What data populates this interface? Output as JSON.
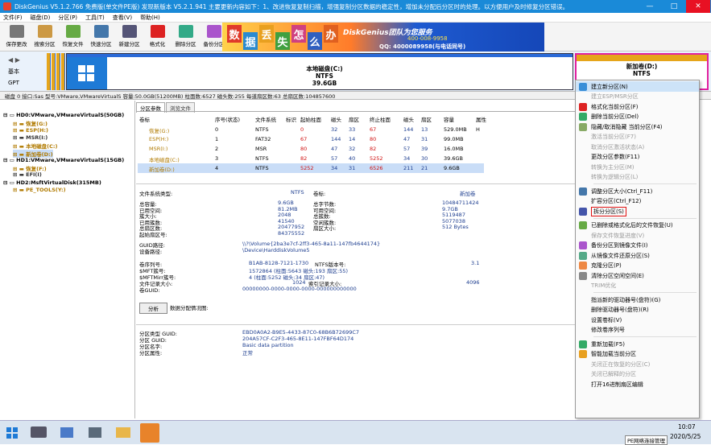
{
  "window": {
    "title": "DiskGenius V5.1.2.766 免费版(单文件PE版)   发现新版本 V5.2.1.941 主要更新内容如下：1、改进恢复复制扫描，增强复制分区数据的稳定性，增加未分配后分区时的处理。以方便用户及时修复分区错误。",
    "minimize": "—",
    "maximize": "□",
    "close": "✕"
  },
  "menu": [
    "文件(F)",
    "磁盘(D)",
    "分区(P)",
    "工具(T)",
    "查看(V)",
    "帮助(H)"
  ],
  "toolbar": [
    {
      "label": "保存更改",
      "icon": "save-icon",
      "color": "#777"
    },
    {
      "label": "搜索分区",
      "icon": "search-icon",
      "color": "#c94"
    },
    {
      "label": "恢复文件",
      "icon": "recover-icon",
      "color": "#6a4"
    },
    {
      "label": "快速分区",
      "icon": "quick-partition-icon",
      "color": "#47a"
    },
    {
      "label": "新建分区",
      "icon": "new-partition-icon",
      "color": "#557"
    },
    {
      "label": "格式化",
      "icon": "format-icon",
      "color": "#d22"
    },
    {
      "label": "删除分区",
      "icon": "delete-icon",
      "color": "#3a8"
    },
    {
      "label": "备份分区",
      "icon": "backup-icon",
      "color": "#a5c"
    }
  ],
  "banner": {
    "chars": [
      "数",
      "据",
      "丢",
      "失",
      "怎",
      "么",
      "办"
    ],
    "brand": "DiskGenius团队为您服务",
    "phone": "400-008-9958",
    "qq": "QQ: 4000089958(与电话同号)"
  },
  "diskmap": {
    "basic": "基本",
    "gpt": "GPT",
    "c": {
      "name": "本地磁盘(C:)",
      "fs": "NTFS",
      "size": "39.6GB"
    },
    "d": {
      "name": "新加卷(D:)",
      "fs": "NTFS",
      "size": "9.6GB"
    }
  },
  "diskinfo": "磁盘 0 接口:Sas  型号:VMware,VMwareVirtualS  容量:50.0GB(51200MB)  柱面数:6527  磁头数:255  每道扇区数:63  总扇区数:104857600",
  "tree": [
    {
      "text": "HD0:VMware,VMwareVirtualS(50GB)",
      "color": "#000"
    },
    {
      "text": "恢复(G:)",
      "color": "#b07a00"
    },
    {
      "text": "ESP(H:)",
      "color": "#b07a00"
    },
    {
      "text": "MSR(I:)",
      "color": "#333"
    },
    {
      "text": "本地磁盘(C:)",
      "color": "#b07a00"
    },
    {
      "text": "新加卷(D:)",
      "color": "#b07a00"
    },
    {
      "text": "HD1:VMware,VMwareVirtualS(15GB)",
      "color": "#000"
    },
    {
      "text": "恢复(F:)",
      "color": "#b07a00"
    },
    {
      "text": "EFI(I)",
      "color": "#333"
    },
    {
      "text": "HD2:MsftVirtualDisk(315MB)",
      "color": "#000"
    },
    {
      "text": "PE_TOOLS(Y:)",
      "color": "#b07a00"
    }
  ],
  "tabs": [
    "分区参数",
    "浏览文件"
  ],
  "table": {
    "headers": [
      "卷标",
      "序号(状态)",
      "文件系统",
      "标识",
      "起始柱面",
      "磁头",
      "扇区",
      "终止柱面",
      "磁头",
      "扇区",
      "容量",
      "属性"
    ],
    "rows": [
      [
        "恢复(G:)",
        "0",
        "NTFS",
        "",
        "0",
        "32",
        "33",
        "67",
        "144",
        "13",
        "529.0MB",
        "H"
      ],
      [
        "ESP(H:)",
        "1",
        "FAT32",
        "",
        "67",
        "144",
        "14",
        "80",
        "47",
        "31",
        "99.0MB",
        ""
      ],
      [
        "MSR(I:)",
        "2",
        "MSR",
        "",
        "80",
        "47",
        "32",
        "82",
        "57",
        "39",
        "16.0MB",
        ""
      ],
      [
        "本地磁盘(C:)",
        "3",
        "NTFS",
        "",
        "82",
        "57",
        "40",
        "5252",
        "34",
        "30",
        "39.6GB",
        ""
      ],
      [
        "新加卷(D:)",
        "4",
        "NTFS",
        "",
        "5252",
        "34",
        "31",
        "6526",
        "211",
        "21",
        "9.6GB",
        ""
      ]
    ]
  },
  "details": {
    "fs_label": "文件系统类型:",
    "fs": "NTFS",
    "vol_label": "卷标:",
    "vol": "新加卷",
    "rows": [
      [
        "总容量:",
        "9.6GB",
        "总字节数:",
        "10484711424"
      ],
      [
        "已用空间:",
        "81.2MB",
        "可用空间:",
        "9.7GB"
      ],
      [
        "簇大小:",
        "2048",
        "总簇数:",
        "5119487"
      ],
      [
        "已用簇数:",
        "41540",
        "空闲簇数:",
        "5077038"
      ],
      [
        "总扇区数:",
        "20477952",
        "扇区大小:",
        "512 Bytes"
      ],
      [
        "起始扇区号:",
        "84375552",
        "",
        ""
      ]
    ],
    "guid_path_label": "GUID路径:",
    "guid_path": "\\\\?\\Volume{2ba3e7cf-2ff3-465-8a11-147fb4644174}",
    "dev_label": "设备路径:",
    "dev": "\\Device\\HarddiskVolume5",
    "serial_label": "卷序列号:",
    "serial": "B1AB-8128-7121-1730",
    "ntfs_ver_label": "NTFS版本号:",
    "ntfs_ver": "3.1",
    "mft_label": "$MFT簇号:",
    "mft": "1572864 (柱面:5643 磁头:193 扇区:55)",
    "mftmirr_label": "$MFTMirr簇号:",
    "mftmirr": "4 (柱面:5252 磁头:34 扇区:47)",
    "rec_label": "文件记录大小:",
    "rec": "1024",
    "idx_label": "索引记录大小:",
    "idx": "4096",
    "guid_label": "卷GUID:",
    "guid": "00000000-0000-0000-0000-000000000000",
    "analyze_btn": "分析",
    "chart_label": "数据分配情况图:",
    "ptype_label": "分区类型 GUID:",
    "ptype": "EBD0A0A2-B9E5-4433-87C0-68B6B72699C7",
    "pguid_label": "分区 GUID:",
    "pguid": "204A57CF-C2F3-465-8E11-147FBF64D174",
    "pname_label": "分区名字:",
    "pname": "Basic data partition",
    "pattr_label": "分区属性:",
    "pattr": "正常"
  },
  "context_menu": [
    {
      "label": "建立新分区(N)",
      "enabled": true,
      "icon_color": "#3a8fd8",
      "highlight": true
    },
    {
      "label": "建立ESP/MSR分区",
      "enabled": false
    },
    {
      "label": "格式化当前分区(F)",
      "enabled": true,
      "icon_color": "#d22"
    },
    {
      "label": "删除当前分区(Del)",
      "enabled": true,
      "icon_color": "#3a6"
    },
    {
      "label": "隐藏/取消隐藏 当前分区(F4)",
      "enabled": true,
      "icon_color": "#8a6"
    },
    {
      "label": "激活当前分区(F7)",
      "enabled": false
    },
    {
      "label": "取消分区激活状态(A)",
      "enabled": false
    },
    {
      "label": "更改分区参数(F11)",
      "enabled": true
    },
    {
      "label": "转换为主分区(M)",
      "enabled": false
    },
    {
      "label": "转换为逻辑分区(L)",
      "enabled": false
    },
    {
      "sep": true
    },
    {
      "label": "调整分区大小(Ctrl_F11)",
      "enabled": true,
      "icon_color": "#47a"
    },
    {
      "label": "扩容分区(Ctrl_F12)",
      "enabled": true
    },
    {
      "label": "拆分分区(S)",
      "enabled": true,
      "icon_color": "#45a",
      "boxed": true
    },
    {
      "sep": true
    },
    {
      "label": "已删除或格式化后的文件恢复(U)",
      "enabled": true,
      "icon_color": "#6a4"
    },
    {
      "label": "保存文件恢复进度(V)",
      "enabled": false
    },
    {
      "label": "备份分区到镜像文件(I)",
      "enabled": true,
      "icon_color": "#a5c"
    },
    {
      "label": "从镜像文件还原分区(S)",
      "enabled": true,
      "icon_color": "#5a8"
    },
    {
      "label": "克隆分区(P)",
      "enabled": true,
      "icon_color": "#e84"
    },
    {
      "label": "清除分区空闲空间(E)",
      "enabled": true,
      "icon_color": "#888"
    },
    {
      "label": "TRIM优化",
      "enabled": false
    },
    {
      "sep": true
    },
    {
      "label": "指派新的驱动器号(盘符)(G)",
      "enabled": true
    },
    {
      "label": "删除驱动器号(盘符)(R)",
      "enabled": true
    },
    {
      "label": "设置卷标(V)",
      "enabled": true
    },
    {
      "label": "修改卷序列号",
      "enabled": true
    },
    {
      "sep": true
    },
    {
      "label": "重新加载(F5)",
      "enabled": true,
      "icon_color": "#3a6"
    },
    {
      "label": "智能加载当前分区",
      "enabled": true,
      "icon_color": "#e8a020"
    },
    {
      "label": "关闭正在恢复的分区(C)",
      "enabled": false
    },
    {
      "label": "关闭已解释的分区",
      "enabled": false
    },
    {
      "label": "打开16进制扇区编辑",
      "enabled": true
    }
  ],
  "taskbar": {
    "tooltip": "PE网络连接管理",
    "time": "10:07",
    "date": "2020/5/25"
  }
}
